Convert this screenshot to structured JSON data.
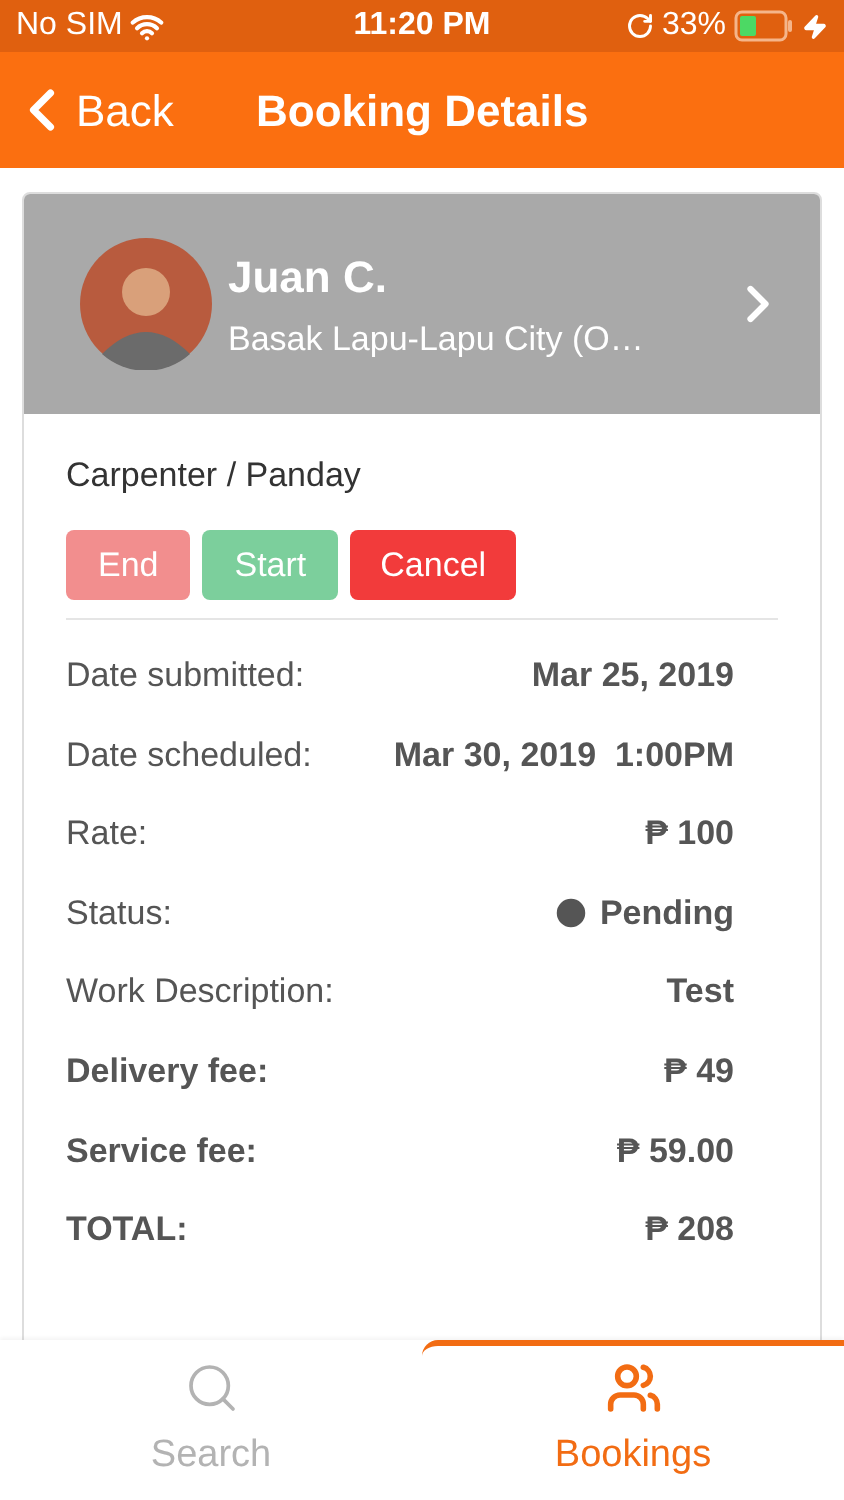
{
  "status_bar": {
    "carrier": "No SIM",
    "time": "11:20 PM",
    "battery": "33%"
  },
  "nav_bar": {
    "back": "Back",
    "title": "Booking Details"
  },
  "worker": {
    "name": "Juan C.",
    "location": "Basak Lapu-Lapu City (O…"
  },
  "service": "Carpenter / Panday",
  "actions": [
    {
      "label": "End",
      "kind": "end",
      "disabled": true
    },
    {
      "label": "Start",
      "kind": "start",
      "disabled": true
    },
    {
      "label": "Cancel",
      "kind": "cancel",
      "disabled": false
    }
  ],
  "details": [
    {
      "label": "Date submitted:",
      "value": "Mar 25, 2019",
      "kind": "plain"
    },
    {
      "label": "Date scheduled:",
      "value": "Mar 30, 2019  1:00PM",
      "kind": "plain"
    },
    {
      "label": "Rate:",
      "value": "₱ 100",
      "kind": "plain"
    },
    {
      "label": "Status:",
      "value": "Pending",
      "kind": "status"
    },
    {
      "label": "Work Description:",
      "value": "Test",
      "kind": "plain"
    },
    {
      "label": "Delivery fee:",
      "value": "₱ 49",
      "kind": "fee"
    },
    {
      "label": "Service fee:",
      "value": "₱ 59.00",
      "kind": "fee"
    },
    {
      "label": "TOTAL:",
      "value": "₱ 208",
      "kind": "fee"
    }
  ],
  "tabs": [
    {
      "label": "Search",
      "kind": "search",
      "selected": false
    },
    {
      "label": "Bookings",
      "kind": "people",
      "selected": true
    }
  ]
}
